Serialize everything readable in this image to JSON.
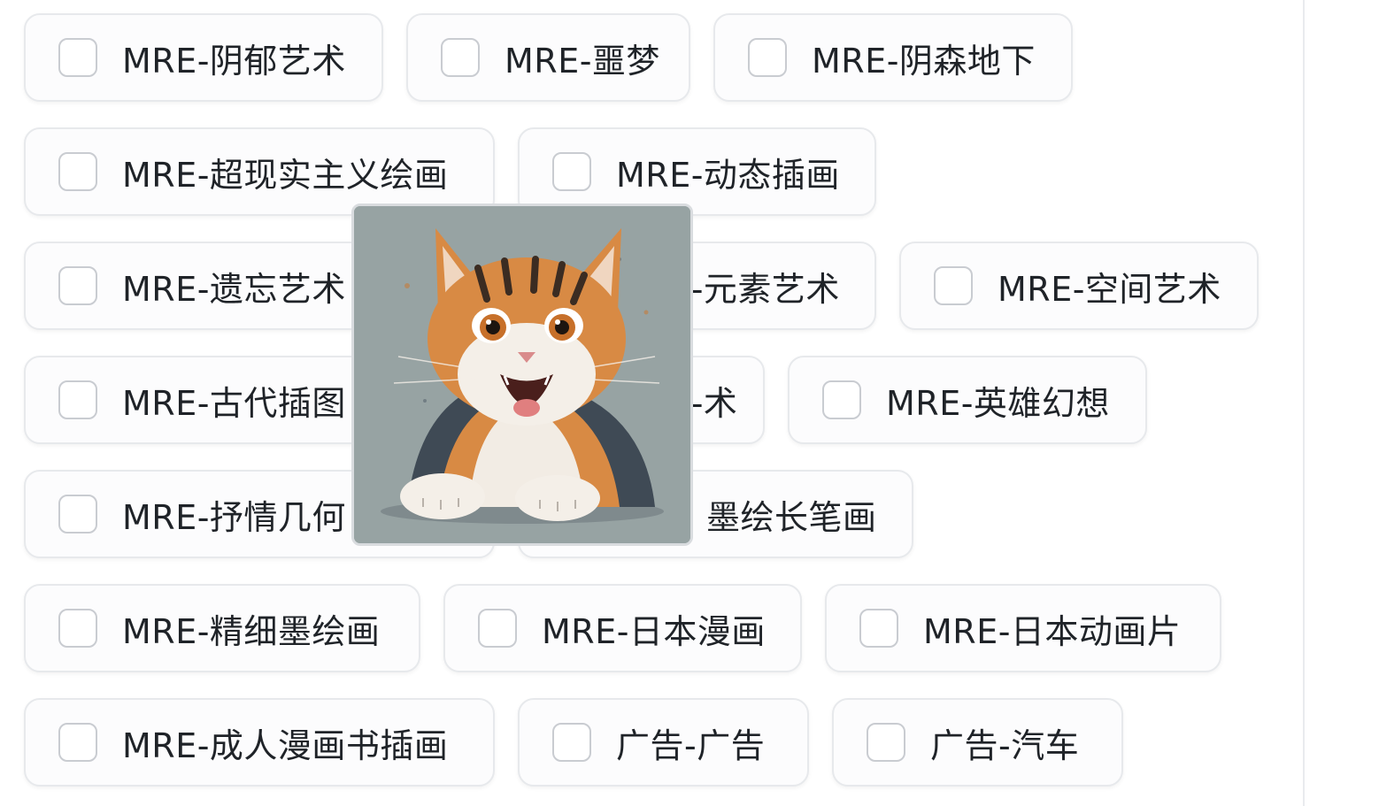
{
  "options": [
    {
      "label": "MRE-阴郁艺术",
      "checked": false
    },
    {
      "label": "MRE-噩梦",
      "checked": false
    },
    {
      "label": "MRE-阴森地下",
      "checked": false
    },
    {
      "label": "MRE-超现实主义绘画",
      "checked": false
    },
    {
      "label": "MRE-动态插画",
      "checked": false
    },
    {
      "label": "MRE-遗忘艺术",
      "checked": false
    },
    {
      "label": "MRE-元素艺术",
      "checked": false
    },
    {
      "label": "MRE-空间艺术",
      "checked": false
    },
    {
      "label": "MRE-古代插图",
      "checked": false
    },
    {
      "label": "MRE-术",
      "checked": false
    },
    {
      "label": "MRE-英雄幻想",
      "checked": false
    },
    {
      "label": "MRE-抒情几何",
      "checked": false
    },
    {
      "label": "墨绘长笔画",
      "checked": false
    },
    {
      "label": "MRE-精细墨绘画",
      "checked": false
    },
    {
      "label": "MRE-日本漫画",
      "checked": false
    },
    {
      "label": "MRE-日本动画片",
      "checked": false
    },
    {
      "label": "MRE-成人漫画书插画",
      "checked": false
    },
    {
      "label": "广告-广告",
      "checked": false
    },
    {
      "label": "广告-汽车",
      "checked": false
    }
  ],
  "preview": {
    "subject": "cat-illustration"
  },
  "colors": {
    "chip_border": "#e7e9ec",
    "checkbox_border": "#c9ccd1",
    "text": "#1f2328",
    "preview_bg": "#97a3a3"
  }
}
